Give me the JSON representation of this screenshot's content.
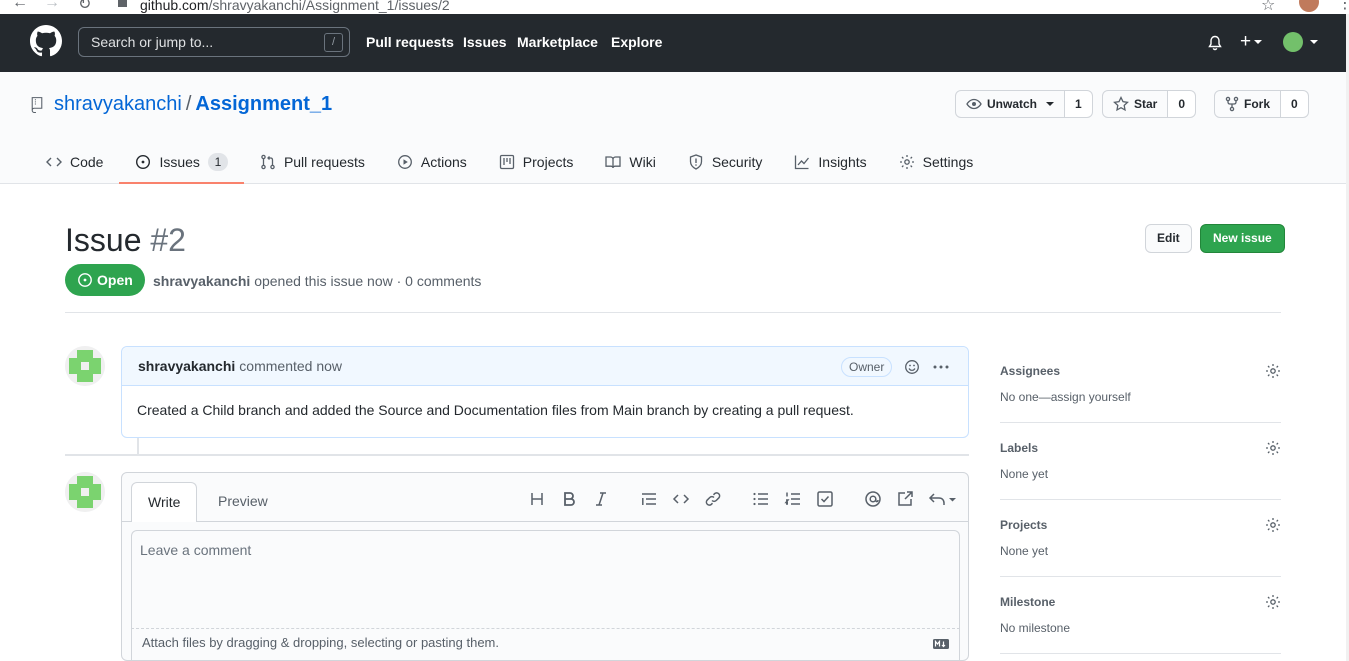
{
  "browser": {
    "url_host": "github.com",
    "url_path": "/shravyakanchi/Assignment_1/issues/2"
  },
  "header": {
    "search_placeholder": "Search or jump to...",
    "search_shortcut": "/",
    "nav": [
      "Pull requests",
      "Issues",
      "Marketplace",
      "Explore"
    ]
  },
  "repo": {
    "owner": "shravyakanchi",
    "separator": "/",
    "name": "Assignment_1",
    "watch_label": "Unwatch",
    "watch_count": "1",
    "star_label": "Star",
    "star_count": "0",
    "fork_label": "Fork",
    "fork_count": "0"
  },
  "tabs": [
    {
      "label": "Code",
      "icon": "code-icon"
    },
    {
      "label": "Issues",
      "icon": "issue-opened-icon",
      "count": "1",
      "selected": true
    },
    {
      "label": "Pull requests",
      "icon": "git-pull-request-icon"
    },
    {
      "label": "Actions",
      "icon": "play-icon"
    },
    {
      "label": "Projects",
      "icon": "project-icon"
    },
    {
      "label": "Wiki",
      "icon": "book-icon"
    },
    {
      "label": "Security",
      "icon": "shield-icon"
    },
    {
      "label": "Insights",
      "icon": "graph-icon"
    },
    {
      "label": "Settings",
      "icon": "gear-icon"
    }
  ],
  "issue": {
    "title": "Issue",
    "number": "#2",
    "edit_label": "Edit",
    "new_issue_label": "New issue",
    "state": "Open",
    "author": "shravyakanchi",
    "meta_text": "opened this issue now · 0 comments"
  },
  "comment": {
    "author": "shravyakanchi",
    "time": "commented now",
    "role": "Owner",
    "body": "Created a Child branch and added the Source and Documentation files from Main branch by creating a pull request."
  },
  "editor": {
    "write_tab": "Write",
    "preview_tab": "Preview",
    "placeholder": "Leave a comment",
    "attach_text": "Attach files by dragging & dropping, selecting or pasting them."
  },
  "sidebar": [
    {
      "title": "Assignees",
      "value": "No one—assign yourself"
    },
    {
      "title": "Labels",
      "value": "None yet"
    },
    {
      "title": "Projects",
      "value": "None yet"
    },
    {
      "title": "Milestone",
      "value": "No milestone"
    }
  ],
  "colors": {
    "header_bg": "#24292e",
    "link": "#0366d6",
    "green": "#2ea44f",
    "tab_underline": "#f9826c",
    "comment_header_bg": "#f1f8ff"
  }
}
